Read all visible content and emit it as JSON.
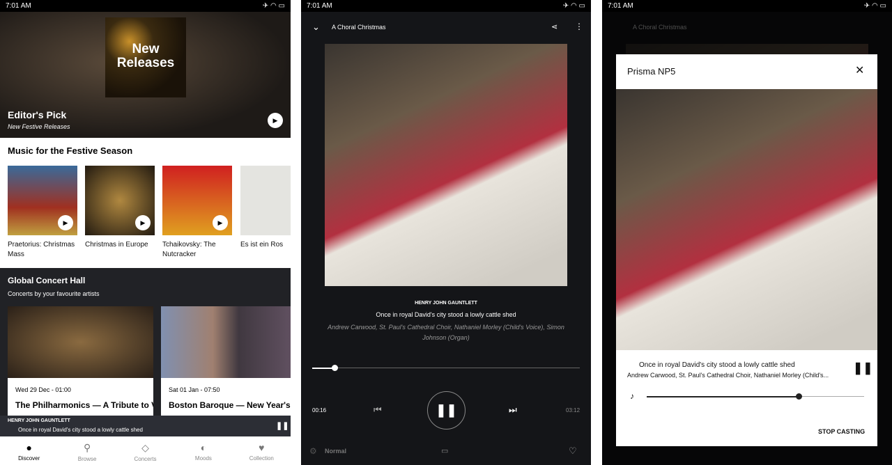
{
  "status": {
    "time": "7:01 AM"
  },
  "discover": {
    "hero": {
      "art_text": "New Releases",
      "title": "Editor's Pick",
      "subtitle": "New Festive Releases"
    },
    "festive": {
      "heading": "Music for the Festive Season",
      "albums": [
        {
          "title": "Praetorius: Christmas Mass"
        },
        {
          "title": "Christmas in Europe"
        },
        {
          "title": "Tchaikovsky: The Nutcracker"
        },
        {
          "title": "Es ist ein Ros"
        }
      ]
    },
    "concerts": {
      "heading": "Global Concert Hall",
      "subtitle": "Concerts by your favourite artists",
      "cards": [
        {
          "date": "Wed 29 Dec - 01:00",
          "title": "The Philharmonics — A Tribute to Vienna"
        },
        {
          "date": "Sat 01 Jan - 07:50",
          "title": "Boston Baroque — New Year's Celebration"
        }
      ]
    },
    "mini_player": {
      "composer": "HENRY JOHN GAUNTLETT",
      "track": "Once in royal David's city stood a lowly cattle shed"
    },
    "nav": [
      {
        "label": "Discover",
        "icon": "compass-icon",
        "active": true
      },
      {
        "label": "Browse",
        "icon": "search-icon"
      },
      {
        "label": "Concerts",
        "icon": "ticket-icon"
      },
      {
        "label": "Moods",
        "icon": "moon-icon"
      },
      {
        "label": "Collection",
        "icon": "heart-icon"
      }
    ]
  },
  "player": {
    "title": "A Choral Christmas",
    "composer": "HENRY JOHN GAUNTLETT",
    "track": "Once in royal David's city stood a lowly cattle shed",
    "performers": "Andrew Carwood, St. Paul's Cathedral Choir, Nathaniel Morley (Child's Voice), Simon Johnson (Organ)",
    "elapsed": "00:16",
    "duration": "03:12",
    "progress": 0.083,
    "quality": "Normal"
  },
  "cast": {
    "device": "Prisma NP5",
    "track": "Once in royal David's city stood a lowly cattle shed",
    "performers": "Andrew Carwood, St. Paul's Cathedral Choir, Nathaniel Morley (Child's...",
    "volume": 0.7,
    "stop_label": "STOP CASTING"
  }
}
